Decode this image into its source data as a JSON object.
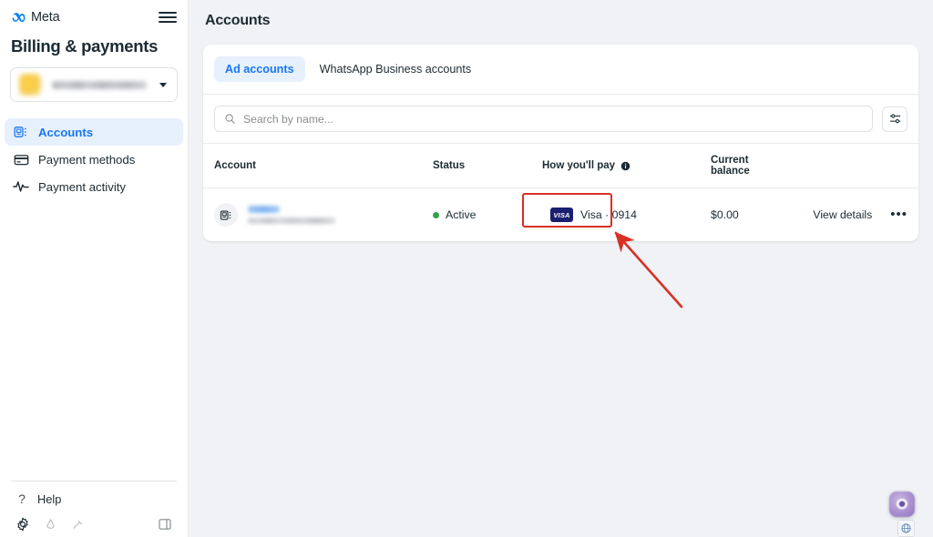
{
  "sidebar": {
    "brand": "Meta",
    "brand_logo_icon": "meta-infinity-icon",
    "menu_icon": "hamburger-menu-icon",
    "title": "Billing & payments",
    "account_selector": {
      "avatar_icon": "business-avatar",
      "value": "",
      "caret_icon": "chevron-down-icon"
    },
    "items": [
      {
        "label": "Accounts",
        "icon": "accounts-icon",
        "active": true
      },
      {
        "label": "Payment methods",
        "icon": "credit-card-icon",
        "active": false
      },
      {
        "label": "Payment activity",
        "icon": "activity-pulse-icon",
        "active": false
      }
    ],
    "help": {
      "label": "Help",
      "icon": "question-mark-icon"
    },
    "bottom_icons": [
      "gear-icon",
      "brightness-icon",
      "tools-icon",
      "panel-toggle-icon"
    ]
  },
  "main": {
    "page_title": "Accounts",
    "tabs": [
      {
        "label": "Ad accounts",
        "active": true
      },
      {
        "label": "WhatsApp Business accounts",
        "active": false
      }
    ],
    "search": {
      "placeholder": "Search by name...",
      "value": "",
      "icon": "search-icon"
    },
    "filter_button": {
      "icon": "filter-sliders-icon"
    },
    "table": {
      "columns": [
        {
          "key": "account",
          "label": "Account"
        },
        {
          "key": "status",
          "label": "Status"
        },
        {
          "key": "pay",
          "label": "How you'll pay",
          "info_icon": "info-icon"
        },
        {
          "key": "balance",
          "label_line1": "Current",
          "label_line2": "balance"
        }
      ],
      "rows": [
        {
          "account_icon": "account-list-icon",
          "account_name": "",
          "account_subtitle": "",
          "status": "Active",
          "status_color": "#31a24c",
          "pay_brand": "VISA",
          "pay_label": "Visa · 0914",
          "balance": "$0.00",
          "view_details": "View details",
          "more_icon": "more-options-icon"
        }
      ]
    }
  },
  "annotations": {
    "highlight_color": "#d93025",
    "arrow_icon": "red-arrow-pointer"
  },
  "widgets": {
    "chat": {
      "icon": "messenger-chat-icon"
    },
    "globe": {
      "icon": "globe-icon"
    }
  }
}
